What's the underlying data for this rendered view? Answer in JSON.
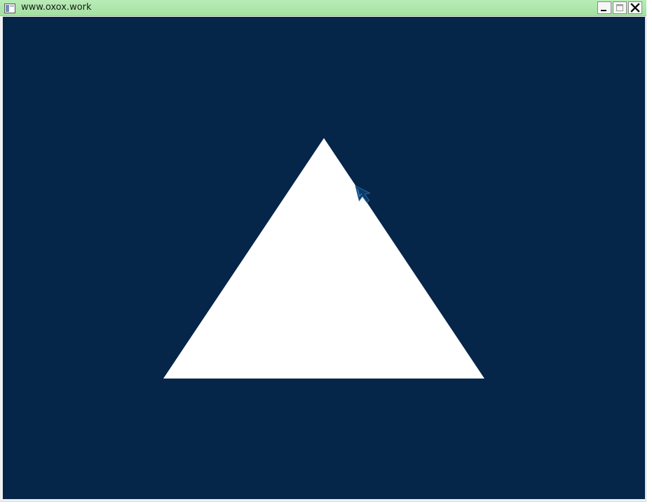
{
  "window": {
    "title": "www.oxox.work",
    "app_icon": "window-icon",
    "controls": [
      {
        "name": "minimize",
        "icon": "minimize-icon"
      },
      {
        "name": "maximize",
        "icon": "maximize-icon"
      },
      {
        "name": "close",
        "icon": "close-icon"
      }
    ]
  },
  "canvas": {
    "background_color": "#052549",
    "shape": "triangle",
    "shape_color": "#ffffff"
  },
  "cursor": {
    "icon": "arrow-cursor-icon"
  }
}
